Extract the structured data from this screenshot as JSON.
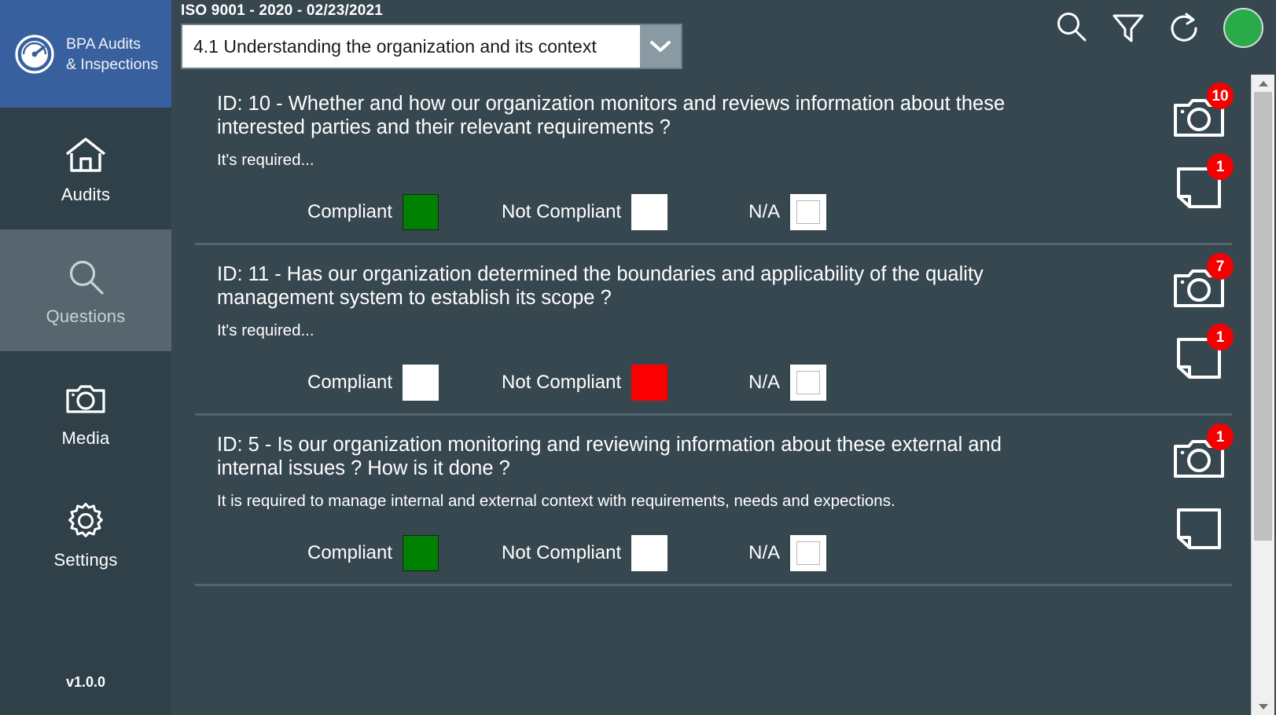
{
  "brand": {
    "name": "BPA Audits\n& Inspections",
    "logo_icon": "gauge-icon"
  },
  "sidebar": {
    "items": [
      {
        "label": "Audits",
        "icon": "home-icon",
        "active": false
      },
      {
        "label": "Questions",
        "icon": "search-icon",
        "active": true
      },
      {
        "label": "Media",
        "icon": "camera-icon",
        "active": false
      },
      {
        "label": "Settings",
        "icon": "gear-icon",
        "active": false
      }
    ],
    "version": "v1.0.0"
  },
  "topbar": {
    "audit_title": "ISO 9001 - 2020 - 02/23/2021",
    "section_selected": "4.1 Understanding the organization and its context",
    "dropdown_icon": "chevron-down-icon",
    "actions": [
      {
        "name": "search-icon",
        "label": "Search"
      },
      {
        "name": "filter-icon",
        "label": "Filter"
      },
      {
        "name": "refresh-icon",
        "label": "Refresh"
      }
    ],
    "status_color": "#2aab4a"
  },
  "answers": {
    "compliant_label": "Compliant",
    "not_compliant_label": "Not Compliant",
    "na_label": "N/A",
    "compliant_color": "#008000",
    "not_compliant_color": "#fa0000"
  },
  "questions": [
    {
      "text": "ID: 10 - Whether and how our organization monitors and reviews information about these interested parties and their relevant requirements ?",
      "note": "It's required...",
      "selected": "compliant",
      "photo_count": "10",
      "note_count": "1"
    },
    {
      "text": "ID: 11 - Has our organization determined the boundaries and applicability of the quality management system to establish its scope ?",
      "note": "It's required...",
      "selected": "not_compliant",
      "photo_count": "7",
      "note_count": "1"
    },
    {
      "text": "ID: 5 - Is our organization monitoring and reviewing information about these external and internal issues ? How is it done ?",
      "note": "It is required to manage  internal and external context with requirements, needs and expections.",
      "selected": "compliant",
      "photo_count": "1",
      "note_count": ""
    }
  ],
  "scrollbar": {
    "up_icon": "arrow-up-icon",
    "down_icon": "arrow-down-icon"
  }
}
